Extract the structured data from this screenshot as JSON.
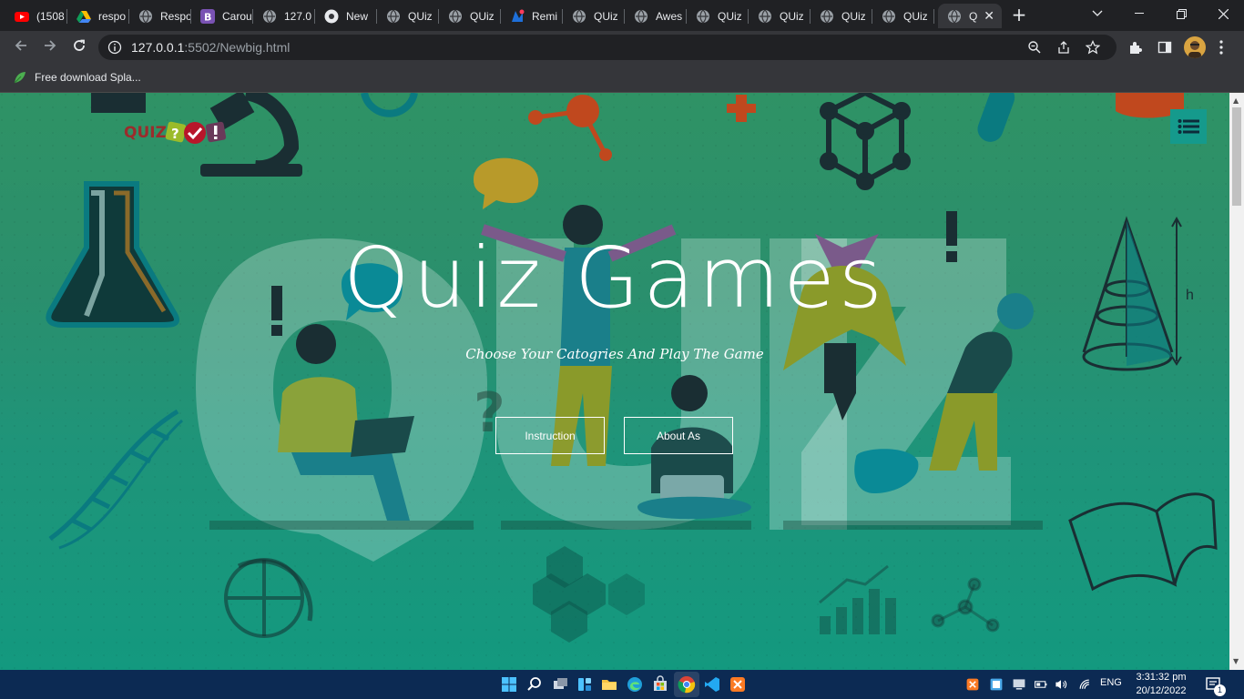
{
  "browser": {
    "tabs": [
      {
        "title": "(1508",
        "icon": "youtube-icon"
      },
      {
        "title": "respo",
        "icon": "google-drive-icon"
      },
      {
        "title": "Respo",
        "icon": "globe-icon"
      },
      {
        "title": "Carou",
        "icon": "bootstrap-icon"
      },
      {
        "title": "127.0",
        "icon": "globe-icon"
      },
      {
        "title": "New",
        "icon": "chrome-icon"
      },
      {
        "title": "QUiz",
        "icon": "globe-icon"
      },
      {
        "title": "QUiz",
        "icon": "globe-icon"
      },
      {
        "title": "Remi",
        "icon": "remix-icon"
      },
      {
        "title": "QUiz",
        "icon": "globe-icon"
      },
      {
        "title": "Awes",
        "icon": "globe-icon"
      },
      {
        "title": "QUiz",
        "icon": "globe-icon"
      },
      {
        "title": "QUiz",
        "icon": "globe-icon"
      },
      {
        "title": "QUiz",
        "icon": "globe-icon"
      },
      {
        "title": "QUiz",
        "icon": "globe-icon"
      },
      {
        "title": "Q",
        "icon": "globe-icon",
        "active": true
      }
    ],
    "new_tab_label": "+",
    "address": {
      "host": "127.0.0.1",
      "rest": ":5502/Newbig.html"
    },
    "bookmark": {
      "label": "Free download Spla...",
      "icon": "leaf-icon"
    }
  },
  "page": {
    "logo_text": "QUIZ",
    "title": "Quiz Games",
    "subtitle": "Choose Your Catogries And Play The Game",
    "buttons": {
      "instruction": "Instruction",
      "about": "About As"
    },
    "background_word": "QUIZ",
    "decor_text": {
      "height_label": "h",
      "question_mark": "?",
      "exclamation": "!"
    }
  },
  "taskbar": {
    "lang": "ENG",
    "time": "3:31:32 pm",
    "date": "20/12/2022",
    "notification_count": "1"
  },
  "colors": {
    "chrome_dark": "#202124",
    "chrome_toolbar": "#35363a",
    "page_green_top": "#2f9265",
    "page_teal_bottom": "#13997f",
    "menu_button": "#159a8c",
    "taskbar": "#0c2a53"
  }
}
